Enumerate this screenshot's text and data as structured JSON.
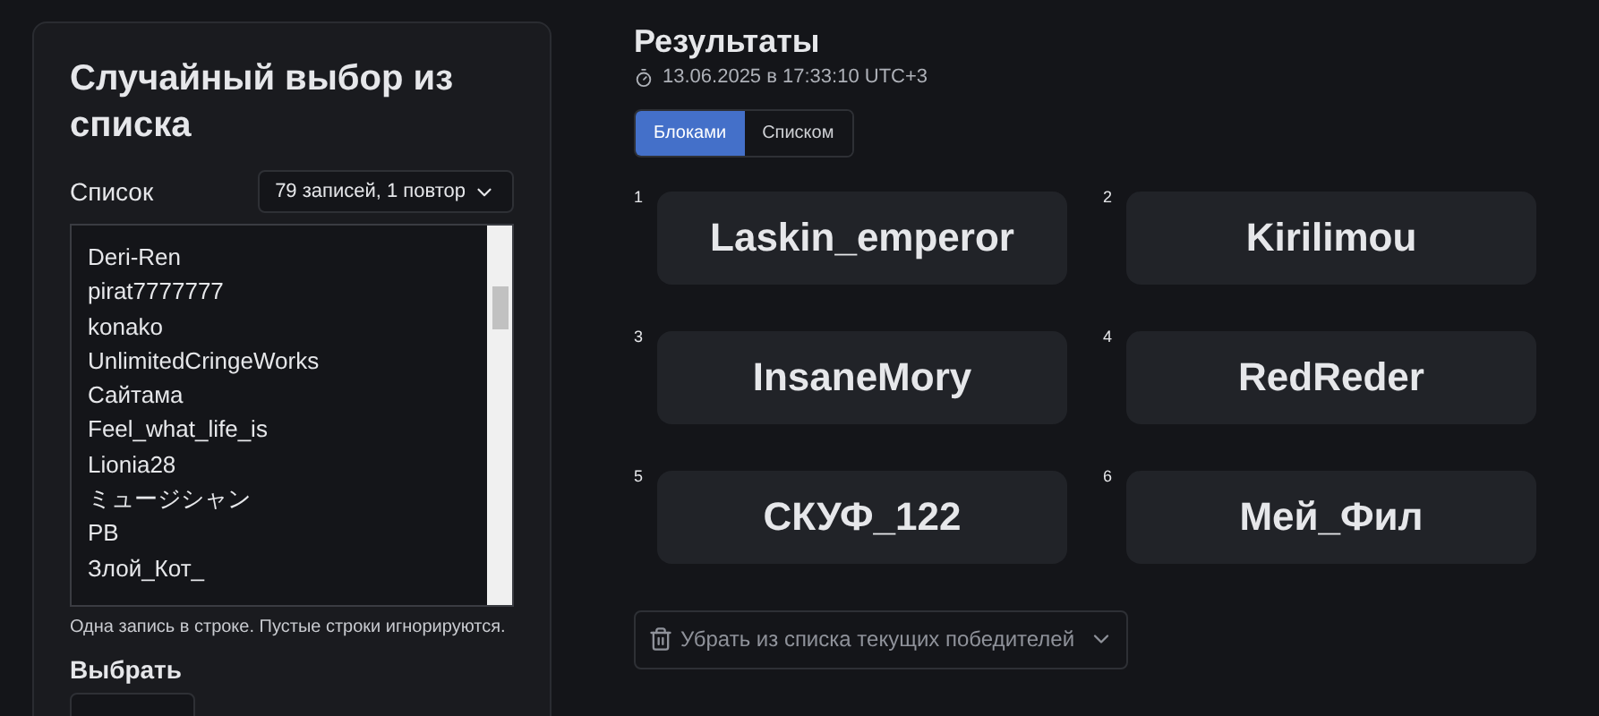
{
  "panel": {
    "title": "Случайный выбор из списка",
    "list_label": "Список",
    "list_summary": "79 записей, 1 повтор",
    "entries": [
      "Deri-Ren",
      "pirat7777777",
      "konako",
      "UnlimitedCringeWorks",
      "Сайтама",
      "Feel_what_life_is",
      "Lionia28",
      "ミュージシャン",
      "PB",
      "Злой_Кот_"
    ],
    "hint": "Одна запись в строке. Пустые строки игнорируются.",
    "pick_label": "Выбрать"
  },
  "results": {
    "title": "Результаты",
    "timestamp": "13.06.2025 в 17:33:10 UTC+3",
    "views": [
      {
        "label": "Блоками",
        "selected": true
      },
      {
        "label": "Списком",
        "selected": false
      }
    ],
    "winners": [
      {
        "number": "1",
        "name": "Laskin_emperor"
      },
      {
        "number": "2",
        "name": "Kirilimou"
      },
      {
        "number": "3",
        "name": "InsaneMory"
      },
      {
        "number": "4",
        "name": "RedReder"
      },
      {
        "number": "5",
        "name": "СКУФ_122"
      },
      {
        "number": "6",
        "name": "Мей_Фил"
      }
    ],
    "remove_button": "Убрать из списка текущих победителей"
  }
}
